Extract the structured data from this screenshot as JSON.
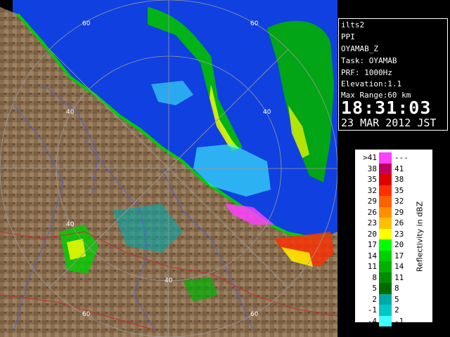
{
  "info_panel": {
    "lines": [
      "ilts2",
      "PPI",
      "OYAMAB_Z",
      "Task: OYAMAB",
      "PRF: 1000Hz",
      "Elevation:1.1",
      "Max Range:60 km"
    ],
    "time": "18:31:03",
    "date": "23 MAR 2012 JST"
  },
  "map": {
    "range_ring_labels": [
      "60",
      "60",
      "40",
      "40",
      "40",
      "40",
      "60",
      "60"
    ],
    "colors": {
      "sea": "#1040e0",
      "land": "#8a6e50",
      "rings": "#9a9a9a"
    }
  },
  "legend": {
    "title": "Reflectivity in dBZ",
    "rows": [
      {
        "low": ">41",
        "high": "---",
        "color": "#ff40ff"
      },
      {
        "low": "38",
        "high": "41",
        "color": "#c00060"
      },
      {
        "low": "35",
        "high": "38",
        "color": "#e00000"
      },
      {
        "low": "32",
        "high": "35",
        "color": "#ff3000"
      },
      {
        "low": "29",
        "high": "32",
        "color": "#ff6000"
      },
      {
        "low": "26",
        "high": "29",
        "color": "#ff9000"
      },
      {
        "low": "23",
        "high": "26",
        "color": "#ffc000"
      },
      {
        "low": "20",
        "high": "23",
        "color": "#ffff00"
      },
      {
        "low": "17",
        "high": "20",
        "color": "#00ff00"
      },
      {
        "low": "14",
        "high": "17",
        "color": "#00d000"
      },
      {
        "low": "11",
        "high": "14",
        "color": "#00b000"
      },
      {
        "low": "8",
        "high": "11",
        "color": "#008c00"
      },
      {
        "low": "5",
        "high": "8",
        "color": "#006c00"
      },
      {
        "low": "2",
        "high": "5",
        "color": "#00a8a8"
      },
      {
        "low": "-1",
        "high": "2",
        "color": "#00c8c8"
      },
      {
        "low": "-4",
        "high": "-1",
        "color": "#40ffff"
      }
    ]
  }
}
